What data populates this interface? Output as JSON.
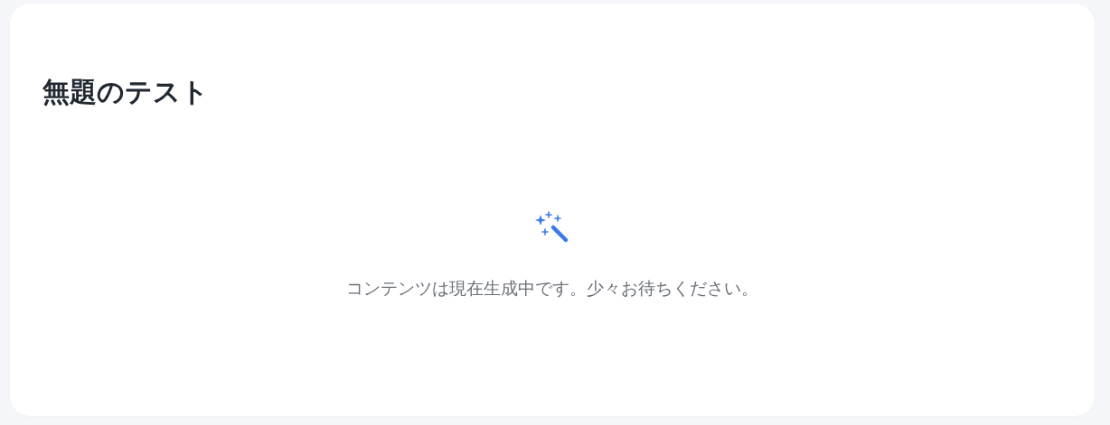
{
  "card": {
    "title": "無題のテスト",
    "message": "コンテンツは現在生成中です。少々お待ちください。"
  }
}
